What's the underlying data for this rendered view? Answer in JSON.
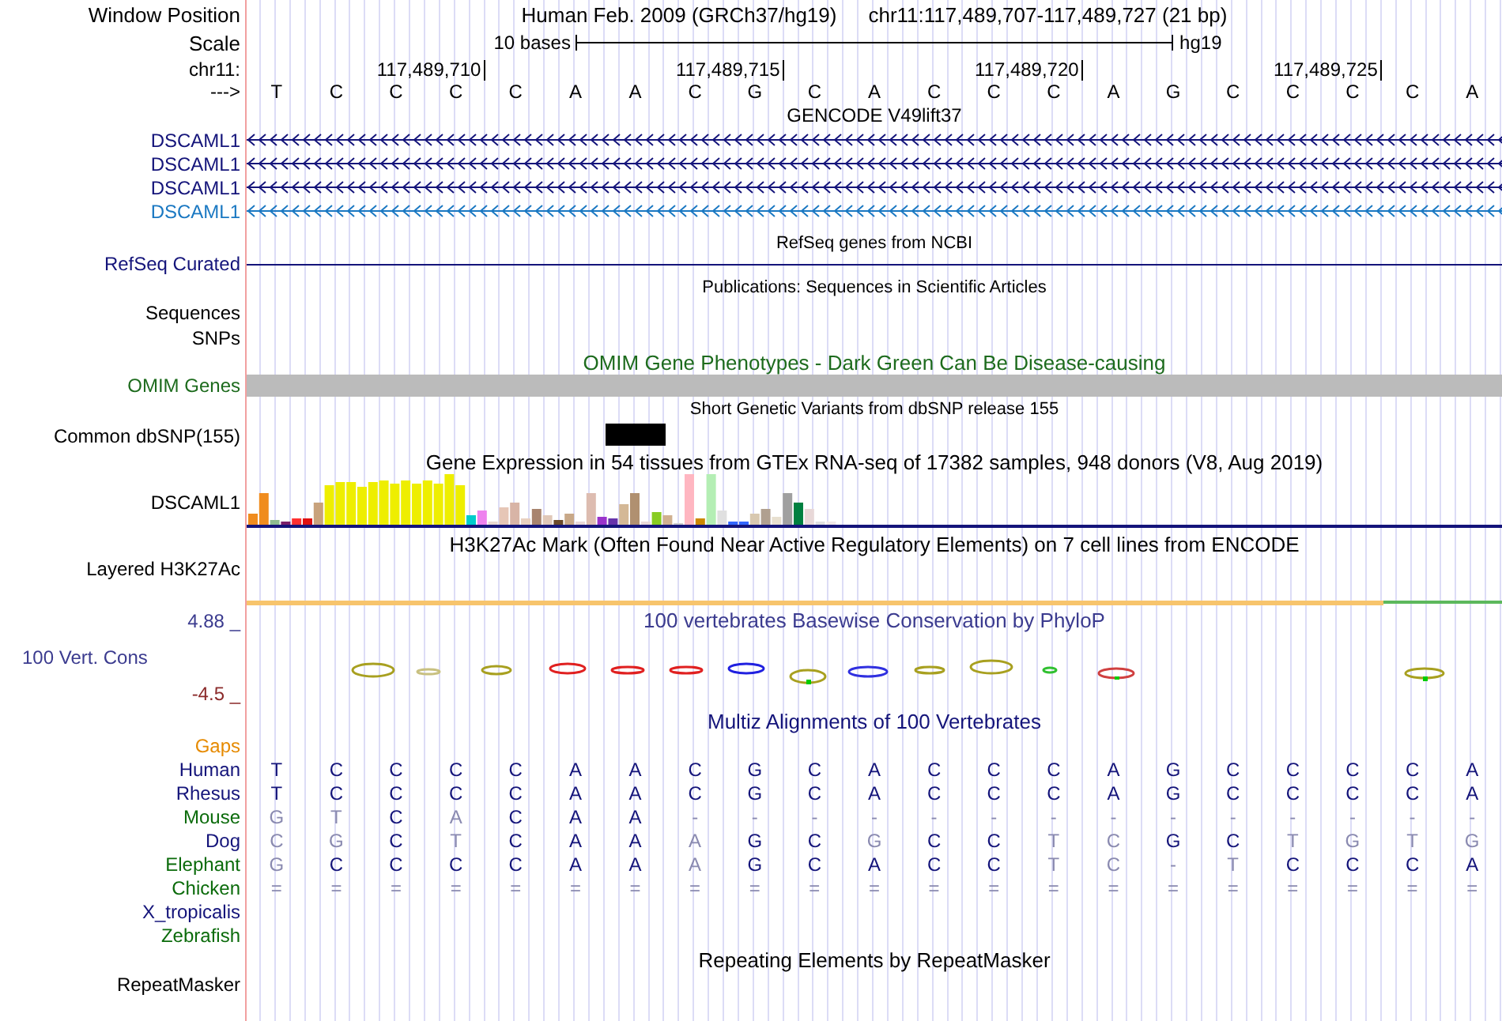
{
  "header": {
    "position_label": "Window Position",
    "assembly": "Human Feb. 2009 (GRCh37/hg19)",
    "position": "chr11:117,489,707-117,489,727 (21 bp)",
    "scale_label": "Scale",
    "scale_text": "10 bases",
    "scale_db": "hg19",
    "chrom_label": "chr11:",
    "strand_label": "--->"
  },
  "bases": [
    {
      "base": "T"
    },
    {
      "base": "C"
    },
    {
      "base": "C"
    },
    {
      "base": "C",
      "tick": "117,489,710"
    },
    {
      "base": "C"
    },
    {
      "base": "A"
    },
    {
      "base": "A"
    },
    {
      "base": "C"
    },
    {
      "base": "G",
      "tick": "117,489,715"
    },
    {
      "base": "C"
    },
    {
      "base": "A"
    },
    {
      "base": "C"
    },
    {
      "base": "C"
    },
    {
      "base": "C",
      "tick": "117,489,720"
    },
    {
      "base": "A"
    },
    {
      "base": "G"
    },
    {
      "base": "C"
    },
    {
      "base": "C"
    },
    {
      "base": "C",
      "tick": "117,489,725"
    },
    {
      "base": "C"
    },
    {
      "base": "A"
    }
  ],
  "tracks": [
    {
      "kind": "genes",
      "title": "GENCODE V49lift37",
      "genes": [
        {
          "name": "DSCAML1",
          "color": "#14147a"
        },
        {
          "name": "DSCAML1",
          "color": "#14147a"
        },
        {
          "name": "DSCAML1",
          "color": "#14147a"
        },
        {
          "name": "DSCAML1",
          "color": "#1a78c2"
        }
      ]
    },
    {
      "kind": "refseq",
      "title": "RefSeq genes from NCBI",
      "label": "RefSeq Curated"
    },
    {
      "kind": "publications",
      "title": "Publications: Sequences in Scientific Articles",
      "labels": [
        "Sequences",
        "SNPs"
      ]
    },
    {
      "kind": "omim",
      "title": "OMIM Gene Phenotypes - Dark Green Can Be Disease-causing",
      "label": "OMIM Genes"
    },
    {
      "kind": "dbsnp",
      "title": "Short Genetic Variants from dbSNP release 155",
      "label": "Common dbSNP(155)"
    },
    {
      "kind": "gtex",
      "title": "Gene Expression in 54 tissues from GTEx RNA-seq of 17382 samples, 948 donors (V8, Aug 2019)",
      "label": "DSCAML1"
    },
    {
      "kind": "h3k27ac",
      "title": "H3K27Ac Mark (Often Found Near Active Regulatory Elements) on 7 cell lines from ENCODE",
      "label": "Layered H3K27Ac"
    },
    {
      "kind": "phylop",
      "title": "100 vertebrates Basewise Conservation by PhyloP",
      "label": "100 Vert. Cons",
      "max_label": "4.88 _",
      "min_label": "-4.5 _"
    },
    {
      "kind": "multiz",
      "title": "Multiz Alignments of 100 Vertebrates",
      "gaps_label": "Gaps",
      "species": [
        {
          "name": "Human",
          "color": "#14147a",
          "bases": [
            {
              "base": "T",
              "dim": false
            },
            {
              "base": "C",
              "dim": false
            },
            {
              "base": "C",
              "dim": false
            },
            {
              "base": "C",
              "dim": false
            },
            {
              "base": "C",
              "dim": false
            },
            {
              "base": "A",
              "dim": false
            },
            {
              "base": "A",
              "dim": false
            },
            {
              "base": "C",
              "dim": false
            },
            {
              "base": "G",
              "dim": false
            },
            {
              "base": "C",
              "dim": false
            },
            {
              "base": "A",
              "dim": false
            },
            {
              "base": "C",
              "dim": false
            },
            {
              "base": "C",
              "dim": false
            },
            {
              "base": "C",
              "dim": false
            },
            {
              "base": "A",
              "dim": false
            },
            {
              "base": "G",
              "dim": false
            },
            {
              "base": "C",
              "dim": false
            },
            {
              "base": "C",
              "dim": false
            },
            {
              "base": "C",
              "dim": false
            },
            {
              "base": "C",
              "dim": false
            },
            {
              "base": "A",
              "dim": false
            }
          ]
        },
        {
          "name": "Rhesus",
          "color": "#14147a",
          "bases": [
            {
              "base": "T",
              "dim": false
            },
            {
              "base": "C",
              "dim": false
            },
            {
              "base": "C",
              "dim": false
            },
            {
              "base": "C",
              "dim": false
            },
            {
              "base": "C",
              "dim": false
            },
            {
              "base": "A",
              "dim": false
            },
            {
              "base": "A",
              "dim": false
            },
            {
              "base": "C",
              "dim": false
            },
            {
              "base": "G",
              "dim": false
            },
            {
              "base": "C",
              "dim": false
            },
            {
              "base": "A",
              "dim": false
            },
            {
              "base": "C",
              "dim": false
            },
            {
              "base": "C",
              "dim": false
            },
            {
              "base": "C",
              "dim": false
            },
            {
              "base": "A",
              "dim": false
            },
            {
              "base": "G",
              "dim": false
            },
            {
              "base": "C",
              "dim": false
            },
            {
              "base": "C",
              "dim": false
            },
            {
              "base": "C",
              "dim": false
            },
            {
              "base": "C",
              "dim": false
            },
            {
              "base": "A",
              "dim": false
            }
          ]
        },
        {
          "name": "Mouse",
          "color": "#0b6b0b",
          "bases": [
            {
              "base": "G",
              "dim": true
            },
            {
              "base": "T",
              "dim": true
            },
            {
              "base": "C",
              "dim": false
            },
            {
              "base": "A",
              "dim": true
            },
            {
              "base": "C",
              "dim": false
            },
            {
              "base": "A",
              "dim": false
            },
            {
              "base": "A",
              "dim": false
            },
            {
              "base": "-",
              "dim": true
            },
            {
              "base": "-",
              "dim": true
            },
            {
              "base": "-",
              "dim": true
            },
            {
              "base": "-",
              "dim": true
            },
            {
              "base": "-",
              "dim": true
            },
            {
              "base": "-",
              "dim": true
            },
            {
              "base": "-",
              "dim": true
            },
            {
              "base": "-",
              "dim": true
            },
            {
              "base": "-",
              "dim": true
            },
            {
              "base": "-",
              "dim": true
            },
            {
              "base": "-",
              "dim": true
            },
            {
              "base": "-",
              "dim": true
            },
            {
              "base": "-",
              "dim": true
            },
            {
              "base": "-",
              "dim": true
            }
          ]
        },
        {
          "name": "Dog",
          "color": "#14147a",
          "bases": [
            {
              "base": "C",
              "dim": true
            },
            {
              "base": "G",
              "dim": true
            },
            {
              "base": "C",
              "dim": false
            },
            {
              "base": "T",
              "dim": true
            },
            {
              "base": "C",
              "dim": false
            },
            {
              "base": "A",
              "dim": false
            },
            {
              "base": "A",
              "dim": false
            },
            {
              "base": "A",
              "dim": true
            },
            {
              "base": "G",
              "dim": false
            },
            {
              "base": "C",
              "dim": false
            },
            {
              "base": "G",
              "dim": true
            },
            {
              "base": "C",
              "dim": false
            },
            {
              "base": "C",
              "dim": false
            },
            {
              "base": "T",
              "dim": true
            },
            {
              "base": "C",
              "dim": true
            },
            {
              "base": "G",
              "dim": false
            },
            {
              "base": "C",
              "dim": false
            },
            {
              "base": "T",
              "dim": true
            },
            {
              "base": "G",
              "dim": true
            },
            {
              "base": "T",
              "dim": true
            },
            {
              "base": "G",
              "dim": true
            }
          ]
        },
        {
          "name": "Elephant",
          "color": "#0b6b0b",
          "bases": [
            {
              "base": "G",
              "dim": true
            },
            {
              "base": "C",
              "dim": false
            },
            {
              "base": "C",
              "dim": false
            },
            {
              "base": "C",
              "dim": false
            },
            {
              "base": "C",
              "dim": false
            },
            {
              "base": "A",
              "dim": false
            },
            {
              "base": "A",
              "dim": false
            },
            {
              "base": "A",
              "dim": true
            },
            {
              "base": "G",
              "dim": false
            },
            {
              "base": "C",
              "dim": false
            },
            {
              "base": "A",
              "dim": false
            },
            {
              "base": "C",
              "dim": false
            },
            {
              "base": "C",
              "dim": false
            },
            {
              "base": "T",
              "dim": true
            },
            {
              "base": "C",
              "dim": true
            },
            {
              "base": "-",
              "dim": true
            },
            {
              "base": "T",
              "dim": true
            },
            {
              "base": "C",
              "dim": false
            },
            {
              "base": "C",
              "dim": false
            },
            {
              "base": "C",
              "dim": false
            },
            {
              "base": "A",
              "dim": false
            }
          ]
        },
        {
          "name": "Chicken",
          "color": "#0b6b0b",
          "bases": [
            {
              "base": "=",
              "dim": true
            },
            {
              "base": "=",
              "dim": true
            },
            {
              "base": "=",
              "dim": true
            },
            {
              "base": "=",
              "dim": true
            },
            {
              "base": "=",
              "dim": true
            },
            {
              "base": "=",
              "dim": true
            },
            {
              "base": "=",
              "dim": true
            },
            {
              "base": "=",
              "dim": true
            },
            {
              "base": "=",
              "dim": true
            },
            {
              "base": "=",
              "dim": true
            },
            {
              "base": "=",
              "dim": true
            },
            {
              "base": "=",
              "dim": true
            },
            {
              "base": "=",
              "dim": true
            },
            {
              "base": "=",
              "dim": true
            },
            {
              "base": "=",
              "dim": true
            },
            {
              "base": "=",
              "dim": true
            },
            {
              "base": "=",
              "dim": true
            },
            {
              "base": "=",
              "dim": true
            },
            {
              "base": "=",
              "dim": true
            },
            {
              "base": "=",
              "dim": true
            },
            {
              "base": "=",
              "dim": true
            }
          ]
        },
        {
          "name": "X_tropicalis",
          "color": "#14147a"
        },
        {
          "name": "Zebrafish",
          "color": "#0b6b0b"
        }
      ]
    },
    {
      "kind": "repeatmasker",
      "title": "Repeating Elements by RepeatMasker",
      "label": "RepeatMasker"
    }
  ]
}
